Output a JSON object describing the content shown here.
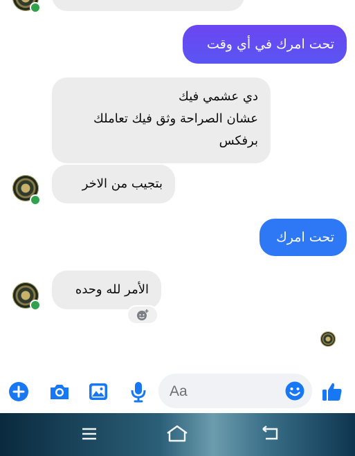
{
  "messages": {
    "m1": {
      "text": "تحت امرك في أي وقت"
    },
    "m2": {
      "line1": "دي عشمي فيك",
      "line2": "عشان الصراحة وثق فيك تعاملك",
      "line3": "برفكس"
    },
    "m3": {
      "text": "بتجيب من الاخر"
    },
    "m4": {
      "text": "تحت امرك"
    },
    "m5": {
      "text": "الأمر لله وحده"
    }
  },
  "composer": {
    "placeholder": "Aa",
    "icons": [
      "plus-icon",
      "camera-icon",
      "gallery-icon",
      "microphone-icon",
      "emoji-icon",
      "thumbs-up-icon"
    ]
  },
  "colors": {
    "accent": "#1877f2",
    "sent_gradient_top": "#6a48f0",
    "sent_blue": "#2f78f5",
    "received_bg": "#ececec",
    "online": "#31a24c"
  },
  "navigation": {
    "icons": [
      "recents-icon",
      "home-icon",
      "back-icon"
    ]
  }
}
